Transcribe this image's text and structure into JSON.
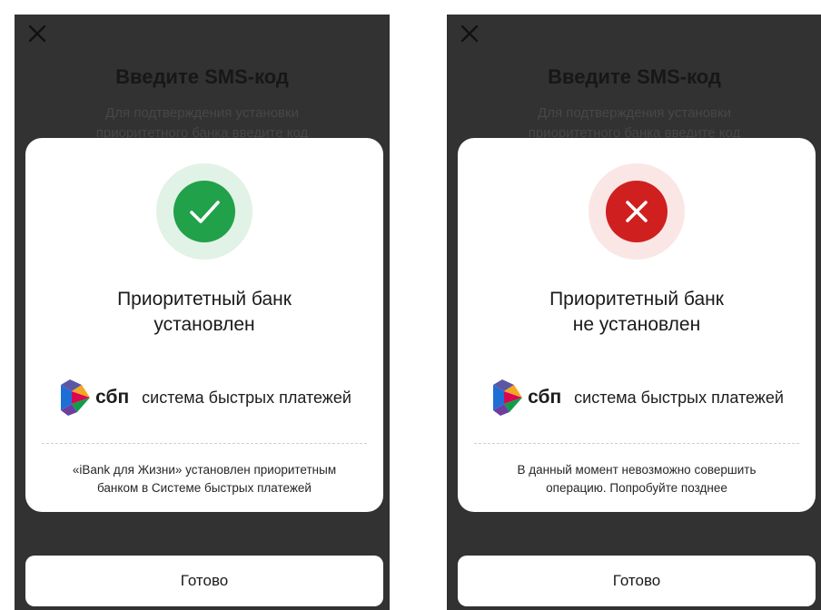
{
  "screens": [
    {
      "status": "success",
      "status_icon": "check-icon",
      "status_color": "#21a149",
      "status_halo_color": "#e1f2e6",
      "close_icon": "close-icon",
      "background": {
        "title": "Введите SMS-код",
        "subtitle_line1": "Для подтверждения установки",
        "subtitle_line2": "приоритетного банка введите код"
      },
      "dialog": {
        "title_line1": "Приоритетный банк",
        "title_line2": "установлен",
        "sbp_short": "сбп",
        "sbp_full": "система быстрых платежей",
        "desc_line1": "«iBank для Жизни» установлен приоритетным",
        "desc_line2": "банком в Системе быстрых платежей"
      },
      "done_label": "Готово"
    },
    {
      "status": "error",
      "status_icon": "cross-icon",
      "status_color": "#d01f1f",
      "status_halo_color": "#fbe6e6",
      "close_icon": "close-icon",
      "background": {
        "title": "Введите SMS-код",
        "subtitle_line1": "Для подтверждения установки",
        "subtitle_line2": "приоритетного банка введите код"
      },
      "dialog": {
        "title_line1": "Приоритетный банк",
        "title_line2": "не установлен",
        "sbp_short": "сбп",
        "sbp_full": "система быстрых платежей",
        "desc_line1": "В данный момент невозможно совершить",
        "desc_line2": "операцию. Попробуйте позднее"
      },
      "done_label": "Готово"
    }
  ],
  "colors": {
    "overlay": "#323232",
    "dialog_bg": "#ffffff",
    "text": "#1a1a1a"
  }
}
